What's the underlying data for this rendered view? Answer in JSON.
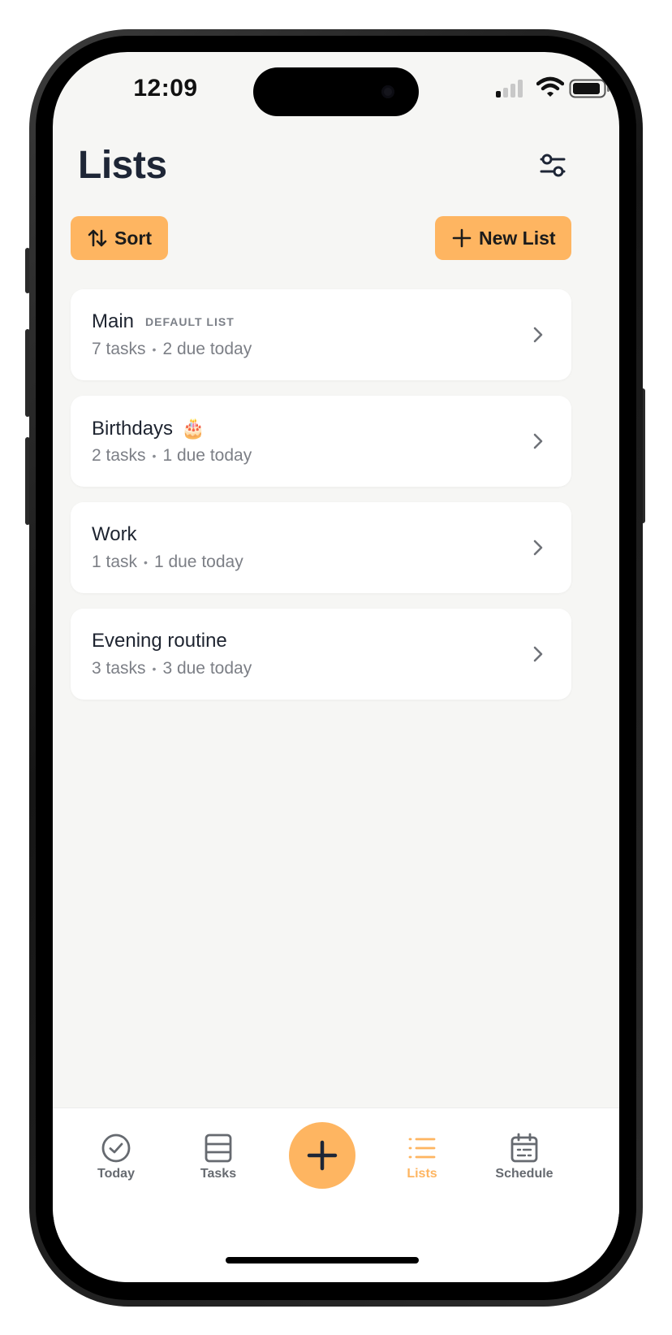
{
  "status_bar": {
    "time": "12:09"
  },
  "header": {
    "title": "Lists",
    "filter_icon": "sliders-icon"
  },
  "actions": {
    "sort_label": "Sort",
    "sort_icon": "sort-arrows-icon",
    "new_list_label": "New List",
    "new_list_icon": "plus-icon"
  },
  "lists": [
    {
      "name": "Main",
      "badge": "DEFAULT LIST",
      "emoji": "",
      "count": "7 tasks",
      "due": "2 due today"
    },
    {
      "name": "Birthdays",
      "badge": "",
      "emoji": "🎂",
      "count": "2 tasks",
      "due": "1 due today"
    },
    {
      "name": "Work",
      "badge": "",
      "emoji": "",
      "count": "1 task",
      "due": "1 due today"
    },
    {
      "name": "Evening routine",
      "badge": "",
      "emoji": "",
      "count": "3 tasks",
      "due": "3 due today"
    }
  ],
  "tabbar": {
    "tabs": [
      {
        "label": "Today",
        "icon": "check-circle-icon",
        "active": false
      },
      {
        "label": "Tasks",
        "icon": "tasks-icon",
        "active": false
      },
      {
        "label": "Lists",
        "icon": "list-icon",
        "active": true
      },
      {
        "label": "Schedule",
        "icon": "calendar-icon",
        "active": false
      }
    ],
    "add_icon": "plus-icon"
  },
  "colors": {
    "accent": "#feb561",
    "background": "#f6f6f4",
    "title": "#1e2636",
    "muted": "#7c7f86"
  }
}
